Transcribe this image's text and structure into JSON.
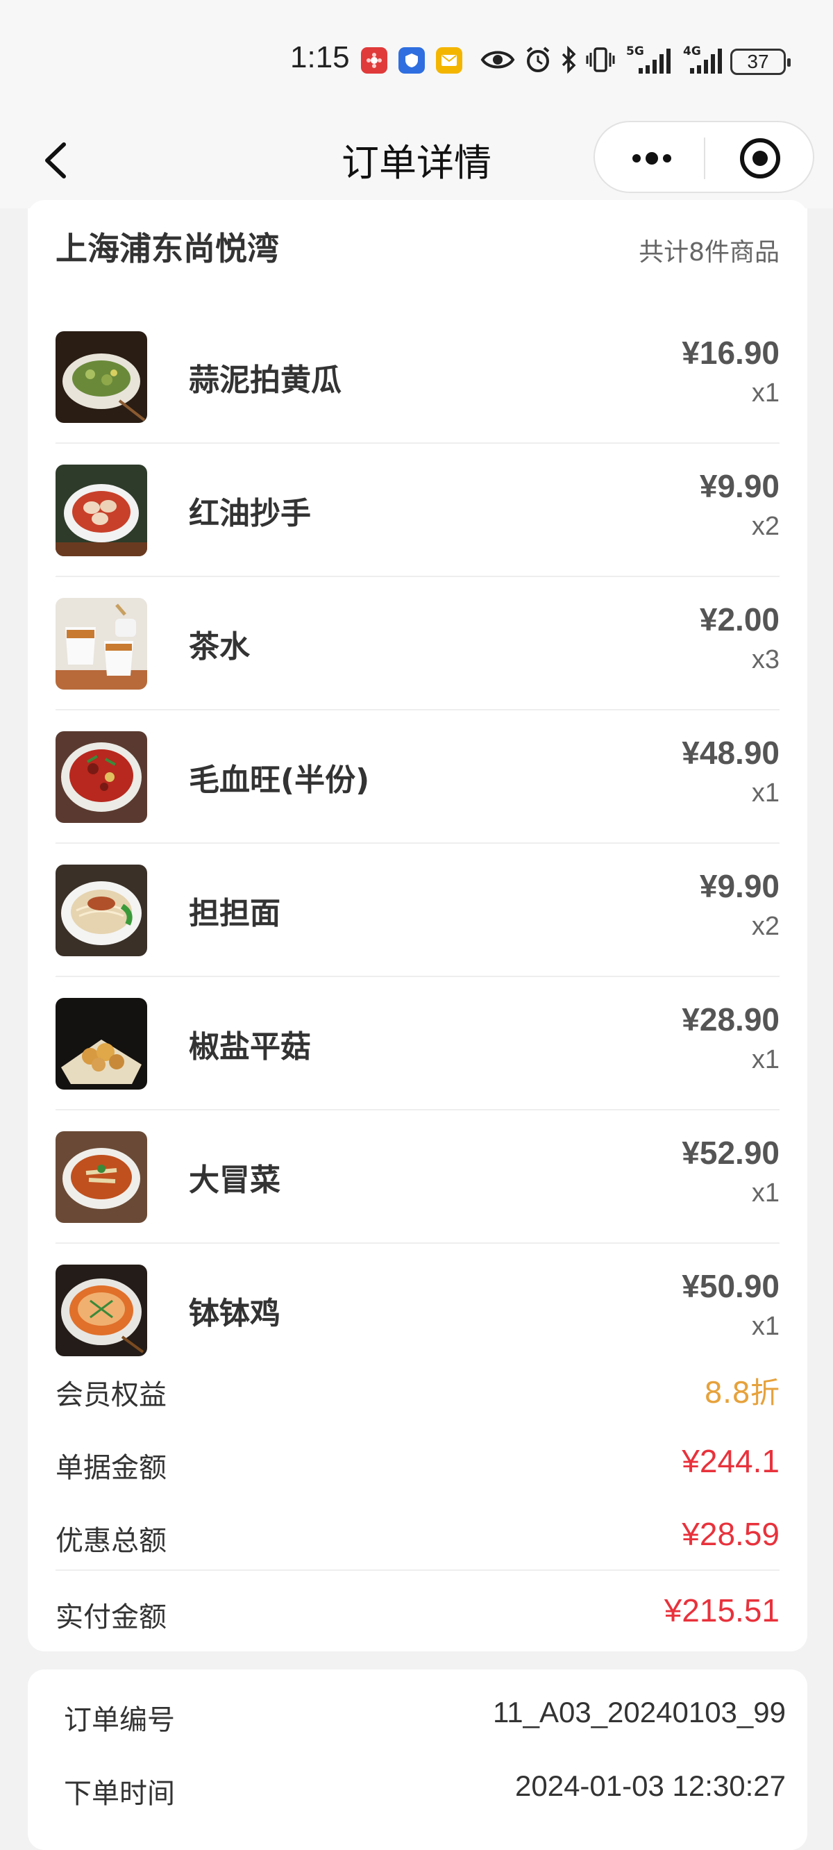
{
  "status_bar": {
    "time": "1:15",
    "battery": "37",
    "signal_1": "5G",
    "signal_2": "4G"
  },
  "nav": {
    "title": "订单详情"
  },
  "order": {
    "store_name": "上海浦东尚悦湾",
    "item_count_text": "共计8件商品",
    "items": [
      {
        "name": "蒜泥拍黄瓜",
        "price": "¥16.90",
        "qty": "x1",
        "image": "cucumber-salad-photo"
      },
      {
        "name": "红油抄手",
        "price": "¥9.90",
        "qty": "x2",
        "image": "wonton-photo"
      },
      {
        "name": "茶水",
        "price": "¥2.00",
        "qty": "x3",
        "image": "tea-photo"
      },
      {
        "name": "毛血旺(半份)",
        "price": "¥48.90",
        "qty": "x1",
        "image": "spicy-stew-photo"
      },
      {
        "name": "担担面",
        "price": "¥9.90",
        "qty": "x2",
        "image": "dandan-noodles-photo"
      },
      {
        "name": "椒盐平菇",
        "price": "¥28.90",
        "qty": "x1",
        "image": "fried-mushroom-photo"
      },
      {
        "name": "大冒菜",
        "price": "¥52.90",
        "qty": "x1",
        "image": "maocai-photo"
      },
      {
        "name": "钵钵鸡",
        "price": "¥50.90",
        "qty": "x1",
        "image": "bobo-chicken-photo"
      }
    ],
    "summary": [
      {
        "label": "会员权益",
        "value": "8.8折",
        "color": "#e6a23c"
      },
      {
        "label": "单据金额",
        "value": "¥244.1",
        "color": "#e8323c"
      },
      {
        "label": "优惠总额",
        "value": "¥28.59",
        "color": "#e8323c"
      },
      {
        "label": "实付金额",
        "value": "¥215.51",
        "color": "#e8323c"
      }
    ]
  },
  "info": {
    "order_no_label": "订单编号",
    "order_no": "11_A03_20240103_99",
    "order_time_label": "下单时间",
    "order_time": "2024-01-03 12:30:27"
  },
  "colors": {
    "accent_orange": "#e6a23c",
    "price_red": "#e8323c"
  }
}
